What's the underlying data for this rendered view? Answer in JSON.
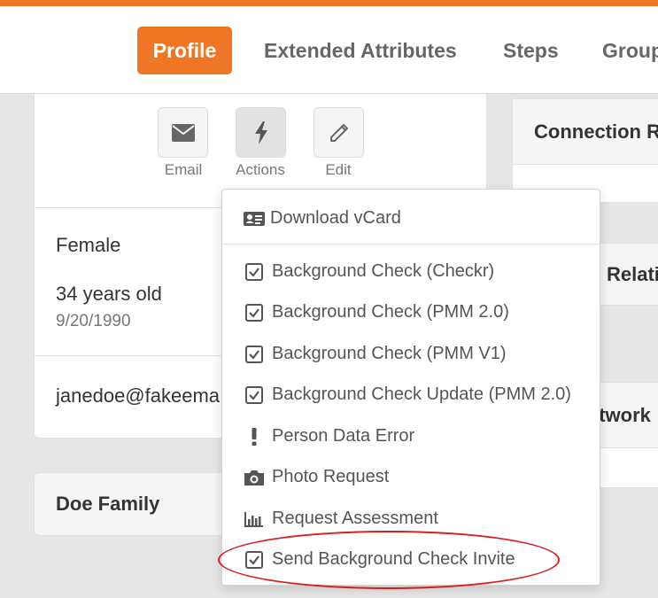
{
  "tabs": [
    {
      "label": "Profile",
      "active": true
    },
    {
      "label": "Extended Attributes"
    },
    {
      "label": "Steps"
    },
    {
      "label": "Group"
    }
  ],
  "actions": [
    {
      "label": "Email",
      "icon": "envelope-icon"
    },
    {
      "label": "Actions",
      "icon": "lightning-icon"
    },
    {
      "label": "Edit",
      "icon": "pencil-icon"
    }
  ],
  "person": {
    "gender": "Female",
    "age": "34 years old",
    "birthdate": "9/20/1990",
    "email": "janedoe@fakeema"
  },
  "family": {
    "name": "Doe Family"
  },
  "right_cards": {
    "connection": "Connection R",
    "relationships": "Relati",
    "network": "etwork"
  },
  "menu": {
    "download": "Download vCard",
    "items": [
      {
        "label": "Background Check (Checkr)",
        "icon": "checkbox-icon"
      },
      {
        "label": "Background Check (PMM 2.0)",
        "icon": "checkbox-icon"
      },
      {
        "label": "Background Check (PMM V1)",
        "icon": "checkbox-icon"
      },
      {
        "label": "Background Check Update (PMM 2.0)",
        "icon": "checkbox-icon"
      },
      {
        "label": "Person Data Error",
        "icon": "exclamation-icon"
      },
      {
        "label": "Photo Request",
        "icon": "camera-icon"
      },
      {
        "label": "Request Assessment",
        "icon": "bar-chart-icon"
      },
      {
        "label": "Send Background Check Invite",
        "icon": "checkbox-icon"
      }
    ]
  },
  "colors": {
    "accent": "#ee7624",
    "highlight": "#d62020"
  }
}
